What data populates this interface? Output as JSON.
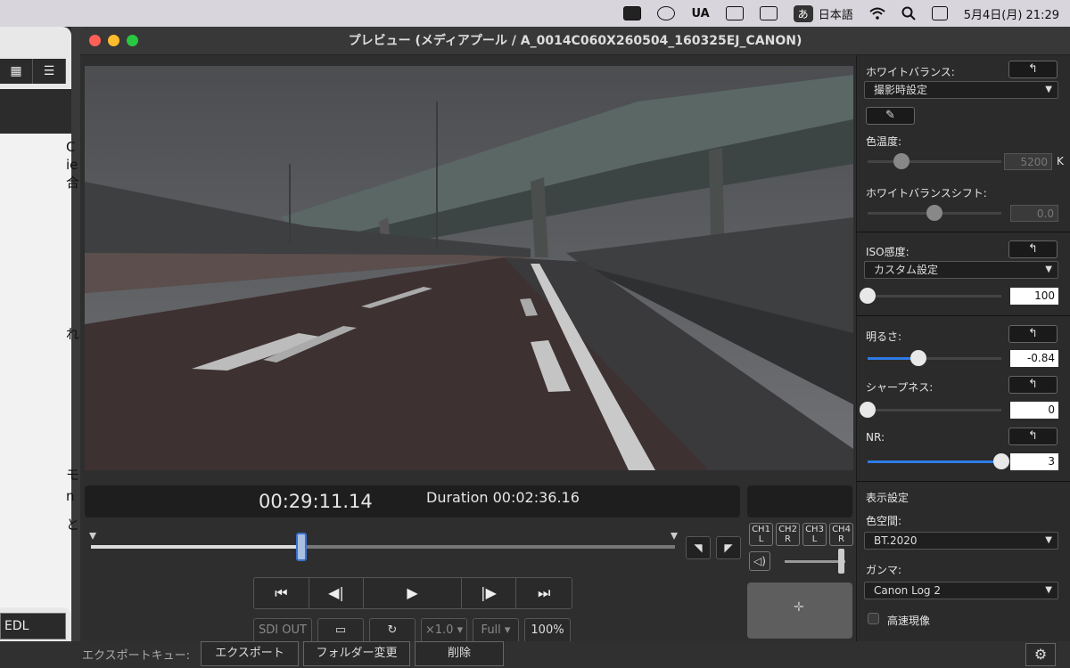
{
  "menubar": {
    "lang_kana": "あ",
    "lang_label": "日本語",
    "ua_label": "UA",
    "datetime": "5月4日(月)  21:29"
  },
  "background_app": {
    "bottom_button": "EDL"
  },
  "window": {
    "title": "プレビュー (メディアプール / A_0014C060X260504_160325EJ_CANON)"
  },
  "timecode": {
    "current": "00:29:11.14",
    "duration": "Duration 00:02:36.16"
  },
  "scrub": {
    "position": 0.36
  },
  "audio_channels": [
    {
      "name": "CH1",
      "side": "L"
    },
    {
      "name": "CH2",
      "side": "R"
    },
    {
      "name": "CH3",
      "side": "L"
    },
    {
      "name": "CH4",
      "side": "R"
    }
  ],
  "transport": {
    "sdi_out": "SDI OUT",
    "speed": "×1.0 ▾",
    "res": "Full ▾",
    "zoom": "100%"
  },
  "panel": {
    "white_balance_label": "ホワイトバランス:",
    "white_balance_value": "撮影時設定",
    "color_temp_label": "色温度:",
    "color_temp_value": "5200",
    "color_temp_unit": "K",
    "wb_shift_label": "ホワイトバランスシフト:",
    "wb_shift_value": "0.0",
    "iso_label": "ISO感度:",
    "iso_mode": "カスタム設定",
    "iso_value": "100",
    "brightness_label": "明るさ:",
    "brightness_value": "-0.84",
    "sharpness_label": "シャープネス:",
    "sharpness_value": "0",
    "nr_label": "NR:",
    "nr_value": "3",
    "display_settings_label": "表示設定",
    "colorspace_label": "色空間:",
    "colorspace_value": "BT.2020",
    "gamma_label": "ガンマ:",
    "gamma_value": "Canon Log 2",
    "fast_dev_label": "高速現像"
  },
  "sliders": {
    "color_temp": 0.25,
    "wb_shift": 0.5,
    "iso": 0.0,
    "brightness": 0.38,
    "sharpness": 0.0,
    "nr": 1.0
  },
  "export_queue": {
    "label": "エクスポートキュー:",
    "export_btn": "エクスポート",
    "folder_btn": "フォルダー変更",
    "delete_btn": "削除"
  }
}
